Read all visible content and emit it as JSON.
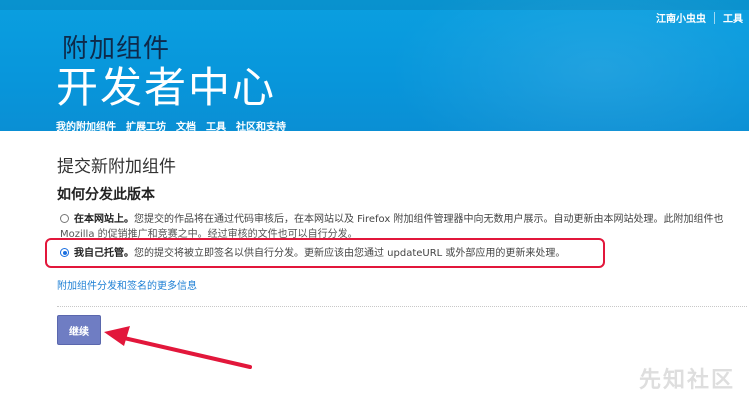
{
  "header": {
    "title_small": "附加组件",
    "title_big": "开发者中心",
    "user_link": "江南小虫虫",
    "tools_link": "工具",
    "nav": [
      "我的附加组件",
      "扩展工坊",
      "文档",
      "工具",
      "社区和支持"
    ]
  },
  "main": {
    "page_title": "提交新附加组件",
    "section_heading": "如何分发此版本",
    "option1": {
      "label": "在本网站上。",
      "text": "您提交的作品将在通过代码审核后，在本网站以及 Firefox 附加组件管理器中向无数用户展示。自动更新由本网站处理。此附加组件也",
      "text2": "Mozilla 的促销推广和竞赛之中。经过审核的文件也可以自行分发。"
    },
    "option2": {
      "label": "我自己托管。",
      "text": "您的提交将被立即签名以供自行分发。更新应该由您通过 updateURL 或外部应用的更新来处理。"
    },
    "more_link": "附加组件分发和签名的更多信息",
    "continue_label": "继续"
  },
  "colors": {
    "header_blue": "#0a9fe0",
    "highlight_red": "#e2173b",
    "button_purple": "#6f7dc3",
    "link_blue": "#1d7fd4"
  },
  "watermark": "先知社区"
}
